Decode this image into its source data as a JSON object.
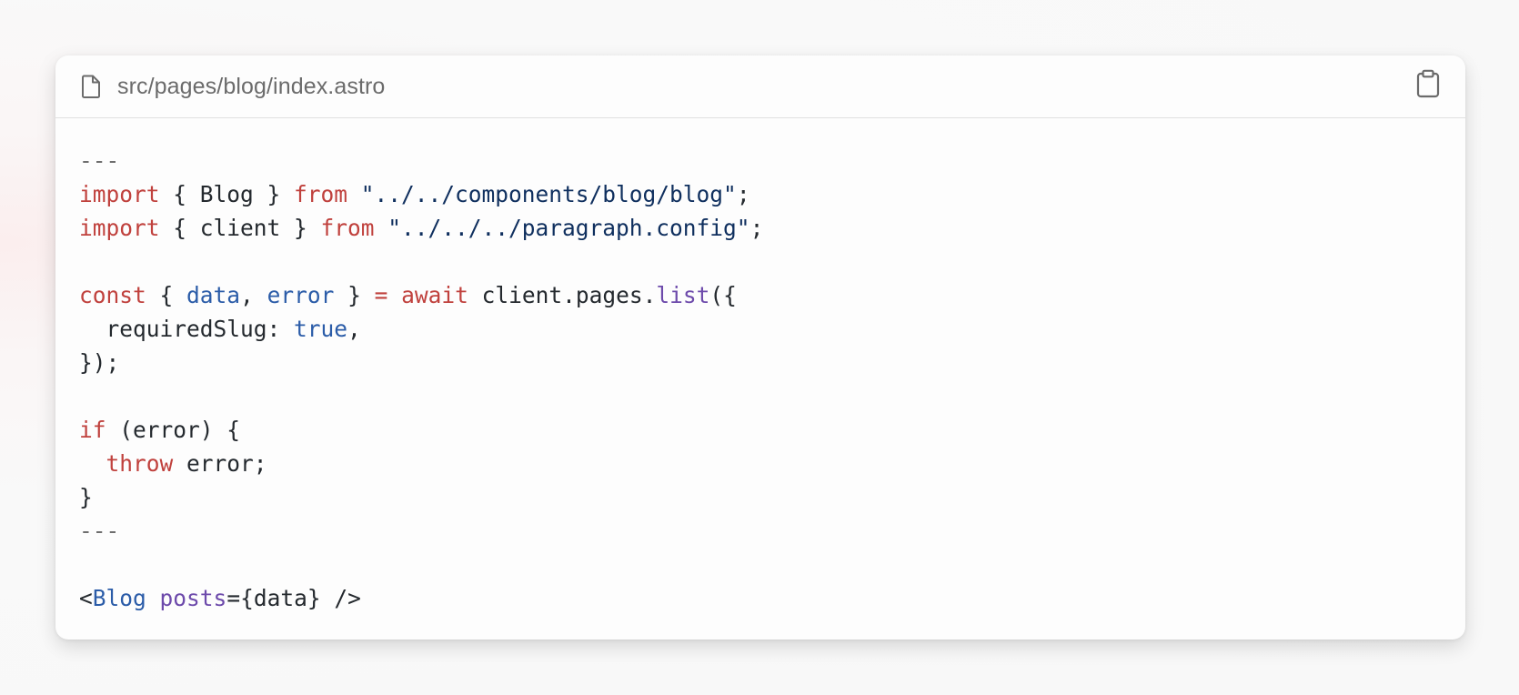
{
  "file": {
    "name": "src/pages/blog/index.astro",
    "icon": "file-icon"
  },
  "copy_button": {
    "icon": "clipboard-icon"
  },
  "colors": {
    "keyword": "#c0413d",
    "string": "#0f2f5e",
    "variable": "#2b5ca8",
    "function": "#6d4aab",
    "plain": "#24292e",
    "fence": "#6e6e6e"
  },
  "code_lines": [
    [
      {
        "t": "---",
        "c": "dim"
      }
    ],
    [
      {
        "t": "import",
        "c": "kw"
      },
      {
        "t": " { Blog } ",
        "c": "plain"
      },
      {
        "t": "from",
        "c": "kw"
      },
      {
        "t": " \"../../components/blog/blog\"",
        "c": "str"
      },
      {
        "t": ";",
        "c": "plain"
      }
    ],
    [
      {
        "t": "import",
        "c": "kw"
      },
      {
        "t": " { client } ",
        "c": "plain"
      },
      {
        "t": "from",
        "c": "kw"
      },
      {
        "t": " \"../../../paragraph.config\"",
        "c": "str"
      },
      {
        "t": ";",
        "c": "plain"
      }
    ],
    [],
    [
      {
        "t": "const",
        "c": "kw"
      },
      {
        "t": " { ",
        "c": "plain"
      },
      {
        "t": "data",
        "c": "var"
      },
      {
        "t": ", ",
        "c": "plain"
      },
      {
        "t": "error",
        "c": "var"
      },
      {
        "t": " } ",
        "c": "plain"
      },
      {
        "t": "=",
        "c": "kw"
      },
      {
        "t": " ",
        "c": "plain"
      },
      {
        "t": "await",
        "c": "kw"
      },
      {
        "t": " client.pages.",
        "c": "plain"
      },
      {
        "t": "list",
        "c": "fn"
      },
      {
        "t": "({",
        "c": "plain"
      }
    ],
    [
      {
        "t": "  requiredSlug: ",
        "c": "plain"
      },
      {
        "t": "true",
        "c": "var"
      },
      {
        "t": ",",
        "c": "plain"
      }
    ],
    [
      {
        "t": "});",
        "c": "plain"
      }
    ],
    [],
    [
      {
        "t": "if",
        "c": "kw"
      },
      {
        "t": " (error) {",
        "c": "plain"
      }
    ],
    [
      {
        "t": "  ",
        "c": "plain"
      },
      {
        "t": "throw",
        "c": "kw"
      },
      {
        "t": " error;",
        "c": "plain"
      }
    ],
    [
      {
        "t": "}",
        "c": "plain"
      }
    ],
    [
      {
        "t": "---",
        "c": "dim"
      }
    ],
    [],
    [
      {
        "t": "<",
        "c": "plain"
      },
      {
        "t": "Blog",
        "c": "tag"
      },
      {
        "t": " ",
        "c": "plain"
      },
      {
        "t": "posts",
        "c": "attr"
      },
      {
        "t": "={data} />",
        "c": "plain"
      }
    ]
  ]
}
